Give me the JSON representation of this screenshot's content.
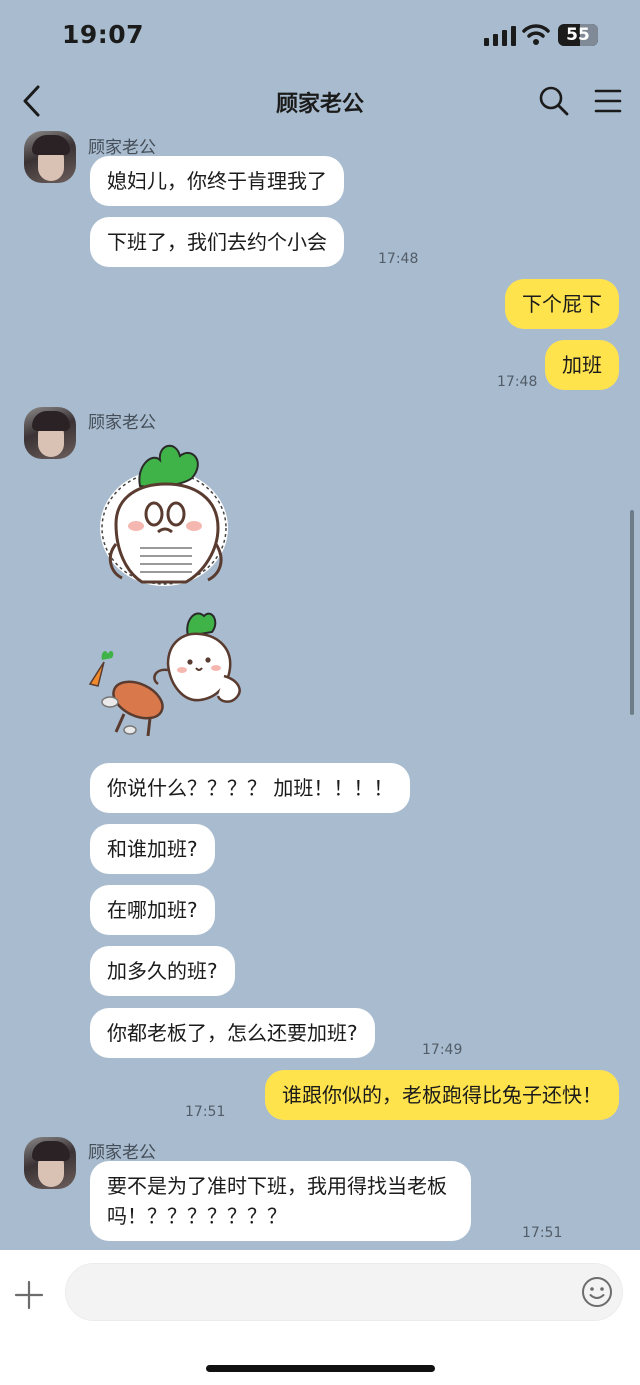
{
  "status_bar": {
    "time": "19:07",
    "battery_level": "55"
  },
  "nav": {
    "title": "顾家老公",
    "back_icon": "chevron-left-icon",
    "search_icon": "search-icon",
    "menu_icon": "menu-icon"
  },
  "messages": [
    {
      "sender": "顾家老公",
      "text": "媳妇儿，你终于肯理我了"
    },
    {
      "text": "下班了，我们去约个小会",
      "time": "17:48"
    },
    {
      "text": "下个屁下"
    },
    {
      "text": "加班",
      "time": "17:48"
    },
    {
      "sender": "顾家老公",
      "sticker": "radish-sticker"
    },
    {
      "sticker": "radish-flip-table-sticker"
    },
    {
      "text": "你说什么？？？？ 加班！！！！"
    },
    {
      "text": "和谁加班?"
    },
    {
      "text": "在哪加班?"
    },
    {
      "text": "加多久的班?"
    },
    {
      "text": "你都老板了，怎么还要加班?",
      "time": "17:49"
    },
    {
      "text": "谁跟你似的，老板跑得比兔子还快！",
      "time": "17:51"
    },
    {
      "sender": "顾家老公",
      "text_line1": "要不是为了准时下班，我用得找当老板",
      "text_line2": "吗！？？？？？？？",
      "time": "17:51"
    }
  ],
  "input": {
    "plus_icon": "plus-icon",
    "emoji_icon": "emoji-icon",
    "placeholder": ""
  },
  "colors": {
    "background": "#a9bccf",
    "incoming_bubble": "#ffffff",
    "outgoing_bubble": "#ffe34d"
  }
}
